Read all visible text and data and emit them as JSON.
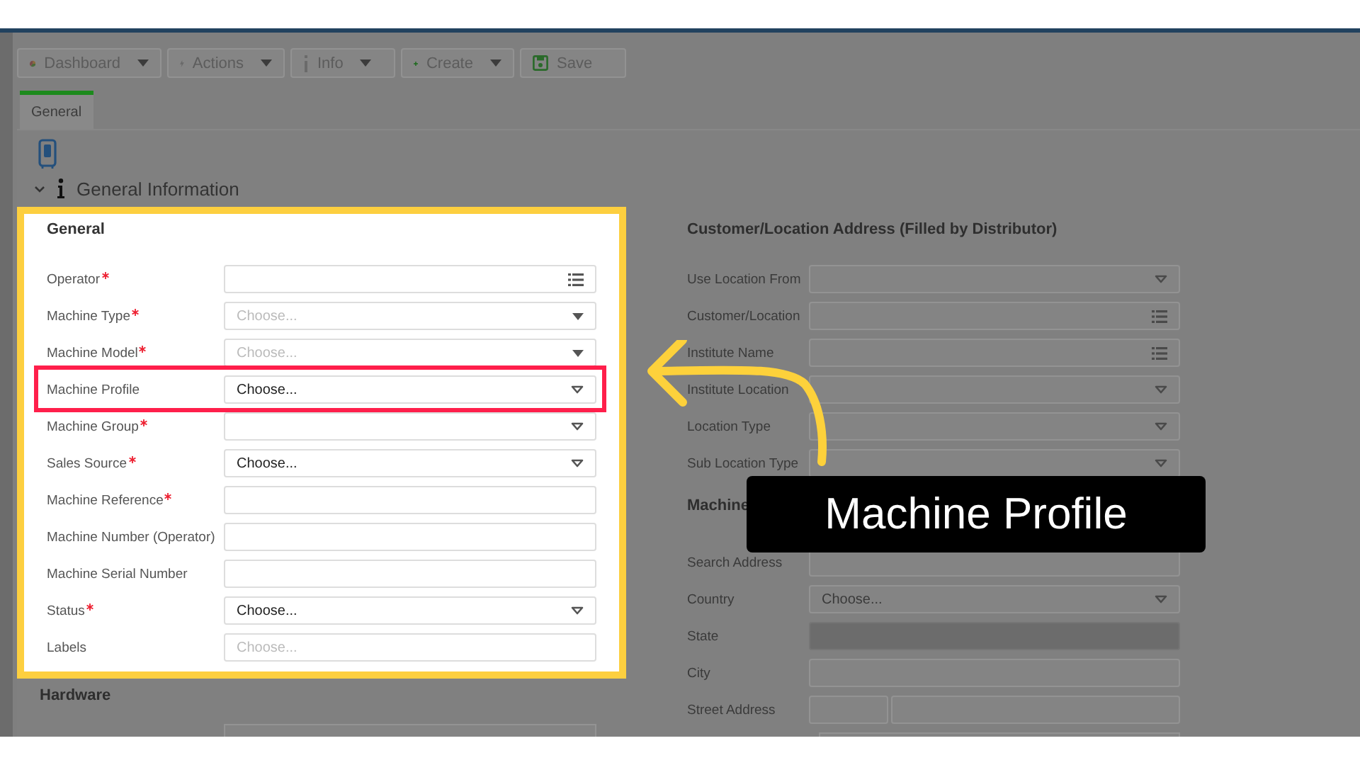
{
  "toolbar": [
    {
      "label": "Dashboard",
      "dropdown": true
    },
    {
      "label": "Actions",
      "dropdown": true
    },
    {
      "label": "Info",
      "dropdown": true
    },
    {
      "label": "Create",
      "dropdown": true
    },
    {
      "label": "Save",
      "dropdown": false
    }
  ],
  "tabs": [
    {
      "label": "General",
      "selected": true
    }
  ],
  "section": {
    "title": "General Information",
    "expanded": true
  },
  "left_form": {
    "title": "General",
    "fields": [
      {
        "label": "Operator",
        "required": true,
        "kind": "list"
      },
      {
        "label": "Machine Type",
        "required": true,
        "kind": "dropdown",
        "placeholder": "Choose..."
      },
      {
        "label": "Machine Model",
        "required": true,
        "kind": "dropdown",
        "placeholder": "Choose..."
      },
      {
        "label": "Machine Profile",
        "required": false,
        "kind": "select",
        "value": "Choose..."
      },
      {
        "label": "Machine Group",
        "required": true,
        "kind": "select"
      },
      {
        "label": "Sales Source",
        "required": true,
        "kind": "select",
        "value": "Choose..."
      },
      {
        "label": "Machine Reference",
        "required": true,
        "kind": "text"
      },
      {
        "label": "Machine Number (Operator)",
        "required": false,
        "kind": "text"
      },
      {
        "label": "Machine Serial Number",
        "required": false,
        "kind": "text"
      },
      {
        "label": "Status",
        "required": true,
        "kind": "select",
        "value": "Choose..."
      },
      {
        "label": "Labels",
        "required": false,
        "kind": "text",
        "placeholder": "Choose..."
      }
    ]
  },
  "hardware": {
    "title": "Hardware"
  },
  "right_form": {
    "title": "Customer/Location Address (Filled by Distributor)",
    "fields": [
      {
        "label": "Use Location From",
        "kind": "select",
        "disabled": false
      },
      {
        "label": "Customer/Location",
        "kind": "list",
        "disabled": false
      },
      {
        "label": "Institute Name",
        "kind": "list",
        "disabled": false
      },
      {
        "label": "Institute Location",
        "kind": "select",
        "disabled": false
      },
      {
        "label": "Location Type",
        "kind": "select",
        "disabled": false
      },
      {
        "label": "Sub Location Type",
        "kind": "select",
        "disabled": false
      }
    ],
    "section_2_title": "Machine",
    "fields_2": [
      {
        "label": "Search Address",
        "kind": "text",
        "disabled": false
      },
      {
        "label": "Country",
        "kind": "select",
        "value": "Choose...",
        "disabled": false
      },
      {
        "label": "State",
        "kind": "text",
        "disabled": true
      },
      {
        "label": "City",
        "kind": "text",
        "disabled": false
      },
      {
        "label": "Street Address",
        "kind": "split",
        "disabled": false
      }
    ]
  },
  "caption": {
    "text": "Machine Profile"
  }
}
